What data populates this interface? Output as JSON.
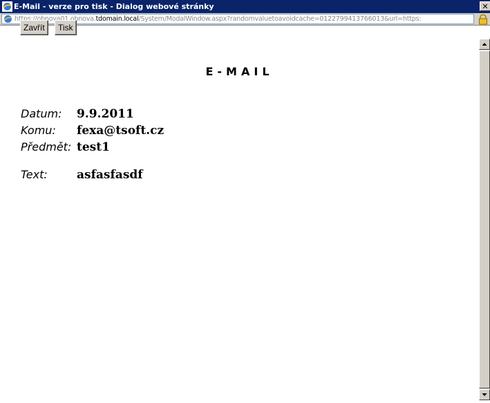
{
  "window": {
    "title": "E-Mail - verze pro tisk - Dialog webové stránky",
    "close_glyph": "✕"
  },
  "address": {
    "url_prefix": "https://obnova01.obnova.",
    "url_domain": "tdomain.local",
    "url_suffix": "/System/ModalWindow.aspx?randomvaluetoavoidcache=0122799413766013&url=https:"
  },
  "toolbar": {
    "close_label": "Zavřít",
    "print_label": "Tisk"
  },
  "email": {
    "heading": "E-MAIL",
    "date_label": "Datum:",
    "date_value": "9.9.2011",
    "to_label": "Komu:",
    "to_value": "fexa@tsoft.cz",
    "subject_label": "Předmět:",
    "subject_value": "test1",
    "text_label": "Text:",
    "text_value": "asfasfasdf"
  }
}
